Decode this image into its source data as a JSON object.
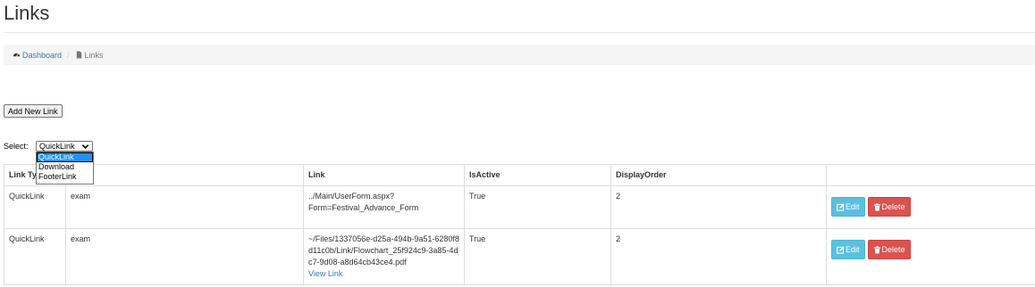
{
  "page": {
    "title": "Links"
  },
  "breadcrumb": {
    "dashboard": "Dashboard",
    "current": "Links"
  },
  "toolbar": {
    "add_label": "Add New Link"
  },
  "filter": {
    "label": "Select:",
    "selected": "QuickLink",
    "options": [
      "QuickLink",
      "Download",
      "FooterLink"
    ]
  },
  "table": {
    "headers": [
      "Link Type",
      "Title",
      "Link",
      "IsActive",
      "DisplayOrder",
      ""
    ],
    "rows": [
      {
        "type": "QuickLink",
        "title": "exam",
        "link": "../Main/UserForm.aspx?Form=Festival_Advance_Form",
        "view_link": "",
        "active": "True",
        "order": "2",
        "edit": "Edit",
        "delete": "Delete"
      },
      {
        "type": "QuickLink",
        "title": "exam",
        "link": "~/Files/1337056e-d25a-494b-9a51-6280f8d11c0b/Link/Flowchart_25f924c9-3a85-4dc7-9d08-a8d64cb43ce4.pdf",
        "view_link": "View Link",
        "active": "True",
        "order": "2",
        "edit": "Edit",
        "delete": "Delete"
      }
    ]
  },
  "colors": {
    "accent": "#337ab7",
    "edit": "#5bc0de",
    "delete": "#d9534f",
    "selected_option": "#1e90ff"
  }
}
